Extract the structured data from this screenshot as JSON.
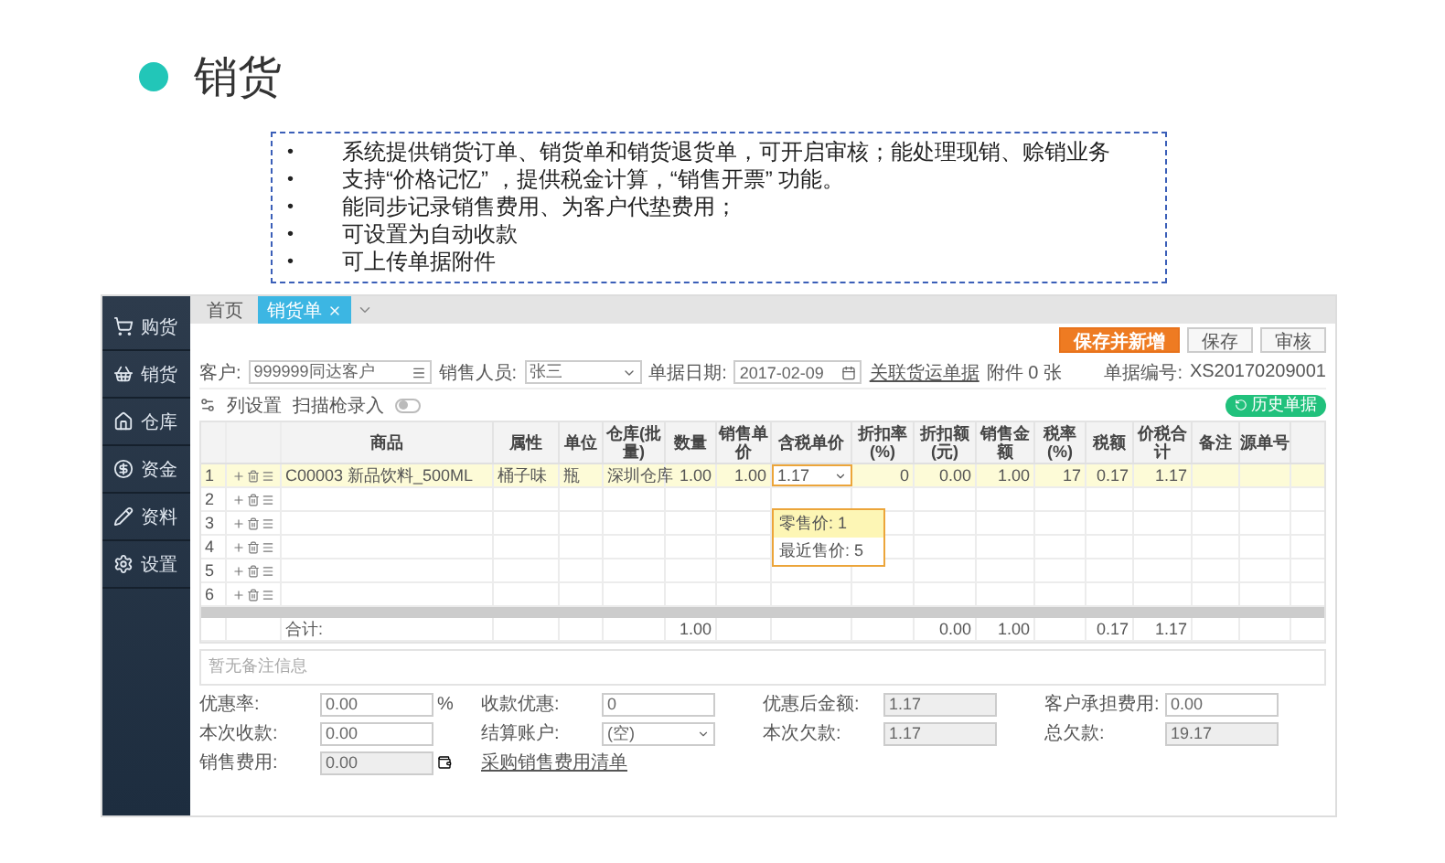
{
  "slide": {
    "title": "销货",
    "bullets": [
      {
        "mark": "•",
        "text": "系统提供销货订单、销货单和销货退货单，可开启审核；能处理现销、赊销业务"
      },
      {
        "mark": "•",
        "text": "支持“价格记忆” ，提供税金计算，“销售开票” 功能。"
      },
      {
        "mark": "•",
        "text": "能同步记录销售费用、为客户代垫费用；"
      },
      {
        "mark": "•",
        "text": "可设置为自动收款"
      },
      {
        "mark": "•",
        "text": "可上传单据附件"
      }
    ]
  },
  "app": {
    "sidebar": [
      {
        "label": "购货"
      },
      {
        "label": "销货"
      },
      {
        "label": "仓库"
      },
      {
        "label": "资金"
      },
      {
        "label": "资料"
      },
      {
        "label": "设置"
      }
    ],
    "tabs": [
      {
        "label": "首页",
        "selected": false
      },
      {
        "label": "销货单",
        "selected": true
      }
    ],
    "actions": [
      {
        "label": "保存并新增",
        "primary": true
      },
      {
        "label": "保存",
        "primary": false
      },
      {
        "label": "审核",
        "primary": false
      }
    ],
    "form": {
      "fields": [
        {
          "label": "客户:",
          "value": "999999同达客户",
          "kind": "lookup"
        },
        {
          "label": "销售人员:",
          "value": "张三",
          "kind": "select"
        },
        {
          "label": "单据日期:",
          "value": "2017-02-09",
          "kind": "date"
        }
      ],
      "link": "关联货运单据",
      "attachment": "附件 0 张",
      "doc_no_label": "单据编号:",
      "doc_no": "XS20170209001"
    },
    "toolbar": {
      "column_settings": "列设置",
      "scan_label": "扫描枪录入",
      "scan_on": false,
      "history": "历史单据"
    },
    "table": {
      "columns": [
        {
          "label": "商品"
        },
        {
          "label": "属性"
        },
        {
          "label": "单位"
        },
        {
          "label": "仓库(批量)"
        },
        {
          "label": "数量",
          "total": "1.00"
        },
        {
          "label": "销售单价"
        },
        {
          "label": "含税单价"
        },
        {
          "label": "折扣率(%)"
        },
        {
          "label": "折扣额(元)",
          "total": "0.00"
        },
        {
          "label": "销售金额",
          "total": "1.00"
        },
        {
          "label": "税率(%)"
        },
        {
          "label": "税额",
          "total": "0.17"
        },
        {
          "label": "价税合计",
          "total": "1.17"
        },
        {
          "label": "备注"
        },
        {
          "label": "源单号"
        }
      ],
      "rows": [
        {
          "no": "1",
          "selected": true,
          "cells": [
            {
              "text": "C00003 新品饮料_500ML",
              "kind": "text"
            },
            {
              "text": "桶子味",
              "kind": "text"
            },
            {
              "text": "瓶",
              "kind": "text"
            },
            {
              "text": "深圳仓库",
              "kind": "text"
            },
            {
              "text": "1.00",
              "kind": "number"
            },
            {
              "text": "1.00",
              "kind": "number"
            },
            {
              "text": "1.17",
              "kind": "select"
            },
            {
              "text": "0",
              "kind": "number"
            },
            {
              "text": "0.00",
              "kind": "number"
            },
            {
              "text": "1.00",
              "kind": "number"
            },
            {
              "text": "17",
              "kind": "number"
            },
            {
              "text": "0.17",
              "kind": "number"
            },
            {
              "text": "1.17",
              "kind": "number"
            }
          ]
        },
        {
          "no": "2",
          "selected": false
        },
        {
          "no": "3",
          "selected": false
        },
        {
          "no": "4",
          "selected": false
        },
        {
          "no": "5",
          "selected": false
        },
        {
          "no": "6",
          "selected": false
        }
      ],
      "dropdown": [
        {
          "label": "零售价: 1",
          "selected": true
        },
        {
          "label": "最近售价: 5",
          "selected": false
        }
      ],
      "totals_label": "合计:"
    },
    "remarks": {
      "placeholder": "暂无备注信息"
    },
    "footer": [
      [
        {
          "label": "优惠率:",
          "value": "0.00",
          "kind": "input",
          "unit": "%"
        },
        {
          "label": "收款优惠:",
          "value": "0",
          "kind": "input"
        },
        {
          "label": "优惠后金额:",
          "value": "1.17",
          "kind": "readonly"
        },
        {
          "label": "客户承担费用:",
          "value": "0.00",
          "kind": "input"
        }
      ],
      [
        {
          "label": "本次收款:",
          "value": "0.00",
          "kind": "input"
        },
        {
          "label": "结算账户:",
          "value": "(空)",
          "kind": "select"
        },
        {
          "label": "本次欠款:",
          "value": "1.17",
          "kind": "readonly"
        },
        {
          "label": "总欠款:",
          "value": "19.17",
          "kind": "readonly"
        }
      ],
      [
        {
          "label": "销售费用:",
          "value": "0.00",
          "kind": "readonly",
          "link": "采购销售费用清单"
        }
      ]
    ]
  }
}
